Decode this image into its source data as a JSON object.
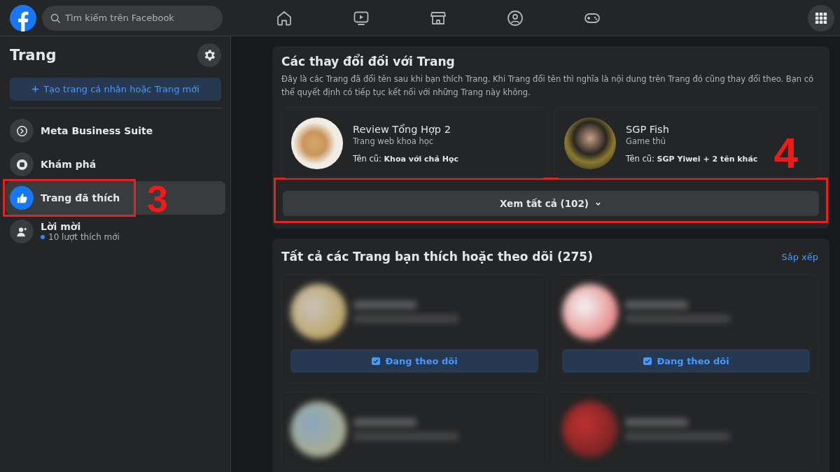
{
  "header": {
    "search": {
      "placeholder": "Tìm kiếm trên Facebook"
    },
    "nav": [
      {
        "kind": "home"
      },
      {
        "kind": "video"
      },
      {
        "kind": "store"
      },
      {
        "kind": "groups"
      },
      {
        "kind": "gaming"
      }
    ]
  },
  "sidebar": {
    "title": "Trang",
    "create_button": "Tạo trang cá nhân hoặc Trang mới",
    "items": [
      {
        "kind": "meta",
        "label": "Meta Business Suite",
        "selected": false
      },
      {
        "kind": "explore",
        "label": "Khám phá",
        "selected": false
      },
      {
        "kind": "liked",
        "label": "Trang đã thích",
        "selected": true,
        "annotation": "3"
      },
      {
        "kind": "invites",
        "label": "Lời mời",
        "subtitle": "10 lượt thích mới",
        "selected": false
      }
    ]
  },
  "changes": {
    "title": "Các thay đổi đối với Trang",
    "description": "Đây là các Trang đã đổi tên sau khi bạn thích Trang. Khi Trang đổi tên thì nghĩa là nội dung trên Trang đó cũng thay đổi theo. Bạn có thể quyết định có tiếp tục kết nối với những Trang này không.",
    "pages": [
      {
        "kind": "bowls",
        "name": "Review Tổng Hợp 2",
        "category": "Trang web khoa học",
        "old_label": "Tên cũ:",
        "old_name": "Khoa với chả Học"
      },
      {
        "kind": "person",
        "name": "SGP Fish",
        "category": "Game thủ",
        "old_label": "Tên cũ:",
        "old_name": "SGP Yiwei + 2 tên khác"
      }
    ],
    "see_all": "Xem tất cả (102)",
    "annotation": "4"
  },
  "following": {
    "title": "Tất cả các Trang bạn thích hoặc theo dõi (275)",
    "sort": "Sắp xếp",
    "pages": [
      {
        "kind": "full",
        "follow_button": "Đang theo dõi"
      },
      {
        "kind": "full",
        "follow_button": "Đang theo dõi"
      },
      {
        "kind": "partial"
      },
      {
        "kind": "partial"
      }
    ]
  }
}
